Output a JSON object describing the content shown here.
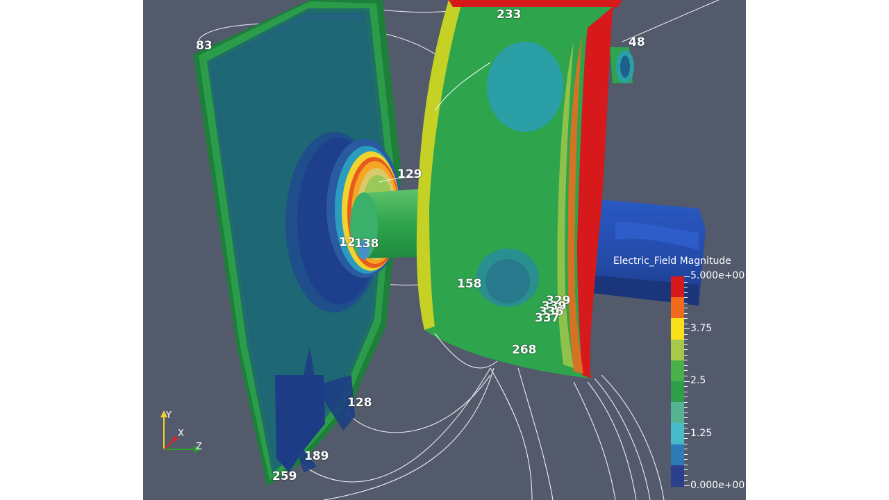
{
  "viewport": {
    "background": "#525a6b"
  },
  "point_labels": [
    {
      "id": "label-83",
      "text": "83"
    },
    {
      "id": "label-233",
      "text": "233"
    },
    {
      "id": "label-48",
      "text": "48"
    },
    {
      "id": "label-129",
      "text": "129"
    },
    {
      "id": "label-12",
      "text": "12"
    },
    {
      "id": "label-138",
      "text": "138"
    },
    {
      "id": "label-158",
      "text": "158"
    },
    {
      "id": "label-329",
      "text": "329"
    },
    {
      "id": "label-339",
      "text": "339"
    },
    {
      "id": "label-336",
      "text": "336"
    },
    {
      "id": "label-337",
      "text": "337"
    },
    {
      "id": "label-268",
      "text": "268"
    },
    {
      "id": "label-128",
      "text": "128"
    },
    {
      "id": "label-189",
      "text": "189"
    },
    {
      "id": "label-259",
      "text": "259"
    }
  ],
  "legend": {
    "title": "Electric_Field Magnitude",
    "max_label": "5.000e+00",
    "label_375": "3.75",
    "label_25": "2.5",
    "label_125": "1.25",
    "min_label": "0.000e+00",
    "colors": [
      "#d7191c",
      "#f26b1d",
      "#f9e01a",
      "#a6c94a",
      "#4ab04a",
      "#2e9e4b",
      "#54b391",
      "#47bcc8",
      "#2c7bb6",
      "#2b3f8c"
    ]
  },
  "axes": {
    "x_label": "X",
    "y_label": "Y",
    "z_label": "Z",
    "x_color": "#d62728",
    "y_color": "#f2d22e",
    "z_color": "#2ca02c"
  }
}
